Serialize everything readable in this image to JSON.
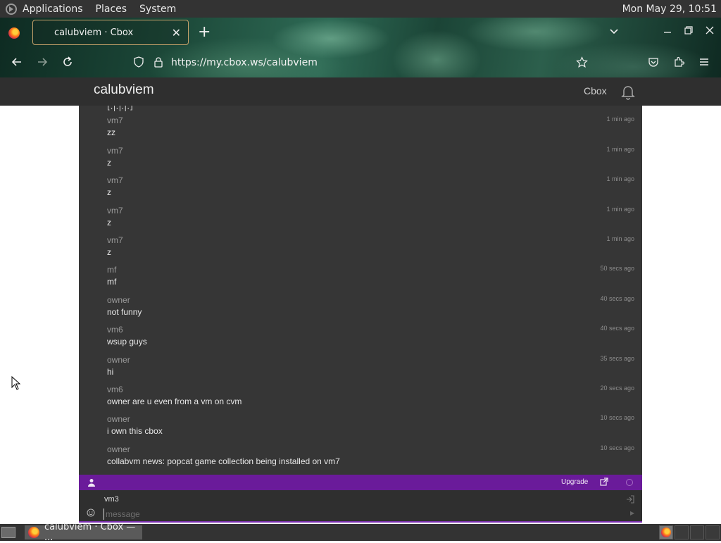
{
  "top_panel": {
    "menus": [
      "Applications",
      "Places",
      "System"
    ],
    "clock": "Mon May 29, 10:51"
  },
  "browser": {
    "tab_title": "calubviem · Cbox",
    "tab_close": "✕",
    "new_tab": "+",
    "url": "https://my.cbox.ws/calubviem"
  },
  "cbox": {
    "title": "calubviem",
    "brand": "Cbox"
  },
  "messages": [
    {
      "user": "vm7",
      "text": "zz",
      "time": "1 min ago"
    },
    {
      "user": "vm7",
      "text": "z",
      "time": "1 min ago"
    },
    {
      "user": "vm7",
      "text": "z",
      "time": "1 min ago"
    },
    {
      "user": "vm7",
      "text": "z",
      "time": "1 min ago"
    },
    {
      "user": "vm7",
      "text": "z",
      "time": "1 min ago"
    },
    {
      "user": "mf",
      "text": "mf",
      "time": "50 secs ago"
    },
    {
      "user": "owner",
      "text": "not funny",
      "time": "40 secs ago"
    },
    {
      "user": "vm6",
      "text": "wsup guys",
      "time": "40 secs ago"
    },
    {
      "user": "owner",
      "text": "hi",
      "time": "35 secs ago"
    },
    {
      "user": "vm6",
      "text": "owner are u even from a vm on cvm",
      "time": "20 secs ago"
    },
    {
      "user": "owner",
      "text": "i own this cbox",
      "time": "10 secs ago"
    },
    {
      "user": "owner",
      "text": "collabvm news: popcat game collection being installed on vm7",
      "time": "10 secs ago"
    }
  ],
  "partial_top_text": "[.|.|.|.]",
  "chat_bar": {
    "upgrade": "Upgrade"
  },
  "input": {
    "name": "vm3",
    "placeholder": "message"
  },
  "taskbar": {
    "task_label": "calubviem · Cbox — ..."
  }
}
